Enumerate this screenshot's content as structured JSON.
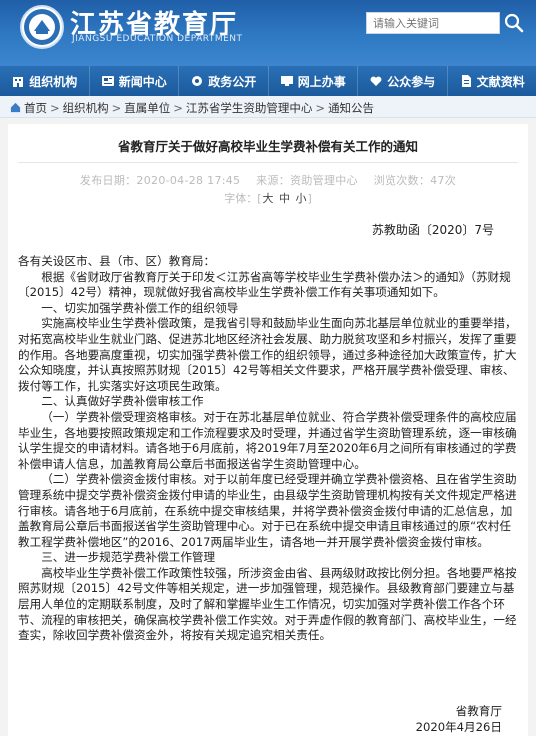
{
  "header": {
    "site_title": "江苏省教育厅",
    "site_subtitle": "JIANGSU EDUCATION DEPARTMENT",
    "search_placeholder": "请输入关键词"
  },
  "nav": [
    {
      "label": "组织机构",
      "icon": "building-icon"
    },
    {
      "label": "新闻中心",
      "icon": "news-icon"
    },
    {
      "label": "政务公开",
      "icon": "gear-icon"
    },
    {
      "label": "网上办事",
      "icon": "monitor-icon"
    },
    {
      "label": "公众参与",
      "icon": "heart-icon"
    },
    {
      "label": "文献资料",
      "icon": "document-icon"
    }
  ],
  "breadcrumb": [
    "首页",
    "组织机构",
    "直属单位",
    "江苏省学生资助管理中心",
    "通知公告"
  ],
  "article": {
    "title": "省教育厅关于做好高校毕业生学费补偿有关工作的通知",
    "publish_date_label": "发布日期：2020-04-28 17:45",
    "source_label": "来源：资助管理中心",
    "views_label": "浏览次数：47次",
    "font_label": "字体：",
    "font_large": "大",
    "font_medium": "中",
    "font_small": "小",
    "doc_number": "苏教助函〔2020〕7号",
    "paragraphs": [
      {
        "indent": false,
        "text": "各有关设区市、县（市、区）教育局："
      },
      {
        "indent": true,
        "text": "根据《省财政厅省教育厅关于印发＜江苏省高等学校毕业生学费补偿办法＞的通知》（苏财规〔2015〕42号）精神，现就做好我省高校毕业生学费补偿工作有关事项通知如下。"
      },
      {
        "indent": true,
        "text": "一、切实加强学费补偿工作的组织领导"
      },
      {
        "indent": true,
        "text": "实施高校毕业生学费补偿政策，是我省引导和鼓励毕业生面向苏北基层单位就业的重要举措，对拓宽高校毕业生就业门路、促进苏北地区经济社会发展、助力脱贫攻坚和乡村振兴，发挥了重要的作用。各地要高度重视，切实加强学费补偿工作的组织领导，通过多种途径加大政策宣传，扩大公众知晓度，并认真按照苏财规〔2015〕42号等相关文件要求，严格开展学费补偿受理、审核、拨付等工作，扎实落实好这项民生政策。"
      },
      {
        "indent": true,
        "text": "二、认真做好学费补偿审核工作"
      },
      {
        "indent": true,
        "text": "（一）学费补偿受理资格审核。对于在苏北基层单位就业、符合学费补偿受理条件的高校应届毕业生，各地要按照政策规定和工作流程要求及时受理，并通过省学生资助管理系统，逐一审核确认学生提交的申请材料。请各地于6月底前，将2019年7月至2020年6月之间所有审核通过的学费补偿申请人信息，加盖教育局公章后书面报送省学生资助管理中心。"
      },
      {
        "indent": true,
        "text": "（二）学费补偿资金拨付审核。对于以前年度已经受理并确立学费补偿资格、且在省学生资助管理系统中提交学费补偿资金拨付申请的毕业生，由县级学生资助管理机构按有关文件规定严格进行审核。请各地于6月底前，在系统中提交审核结果，并将学费补偿资金拨付申请的汇总信息，加盖教育局公章后书面报送省学生资助管理中心。对于已在系统中提交申请且审核通过的原“农村任教工程学费补偿地区”的2016、2017两届毕业生，请各地一并开展学费补偿资金拨付审核。"
      },
      {
        "indent": true,
        "text": "三、进一步规范学费补偿工作管理"
      },
      {
        "indent": true,
        "text": "高校毕业生学费补偿工作政策性较强，所涉资金由省、县两级财政按比例分担。各地要严格按照苏财规〔2015〕42号文件等相关规定，进一步加强管理，规范操作。县级教育部门要建立与基层用人单位的定期联系制度，及时了解和掌握毕业生工作情况，切实加强对学费补偿工作各个环节、流程的审核把关，确保高校学费补偿工作实效。对于弄虚作假的教育部门、高校毕业生，一经查实，除收回学费补偿资金外，将按有关规定追究相关责任。"
      }
    ],
    "signoff_org": "省教育厅",
    "signoff_date": "2020年4月26日"
  },
  "colors": {
    "header_blue": "#2f79c3",
    "nav_blue": "#1b5a9c",
    "crumb_bg": "#eef3f9"
  }
}
